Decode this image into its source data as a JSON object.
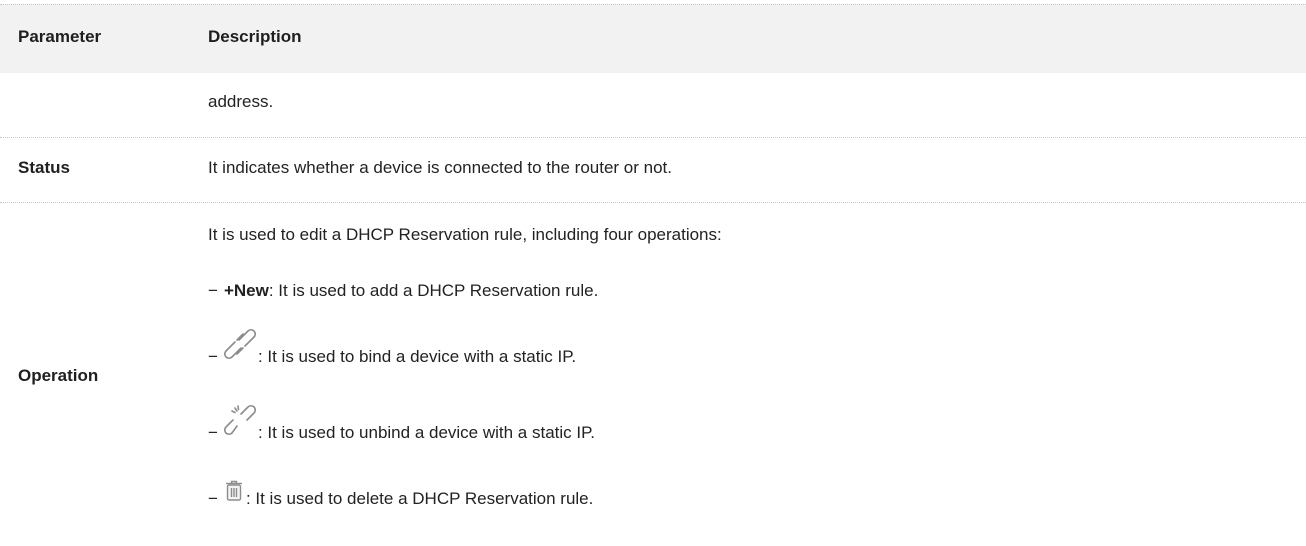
{
  "table": {
    "header": {
      "parameter": "Parameter",
      "description": "Description"
    },
    "rows": [
      {
        "parameter": "",
        "description": "address."
      },
      {
        "parameter": "Status",
        "description": "It indicates whether a device is connected to the router or not."
      },
      {
        "parameter": "Operation",
        "intro": "It is used to edit a DHCP Reservation rule, including four operations:",
        "items": [
          {
            "dash": "−",
            "label": "+New",
            "text": " : It is used to add a DHCP Reservation rule."
          },
          {
            "dash": "−",
            "icon": "link-icon",
            "text": ": It is used to bind a device with a static IP."
          },
          {
            "dash": "−",
            "icon": "unlink-icon",
            "text": ": It is used to unbind a device with a static IP."
          },
          {
            "dash": "−",
            "icon": "trash-icon",
            "text": ": It is used to delete a DHCP Reservation rule."
          }
        ]
      }
    ]
  },
  "colors": {
    "header_bg": "#f2f2f2",
    "divider": "#c8c8c8",
    "icon_gray": "#8c8c8c"
  }
}
